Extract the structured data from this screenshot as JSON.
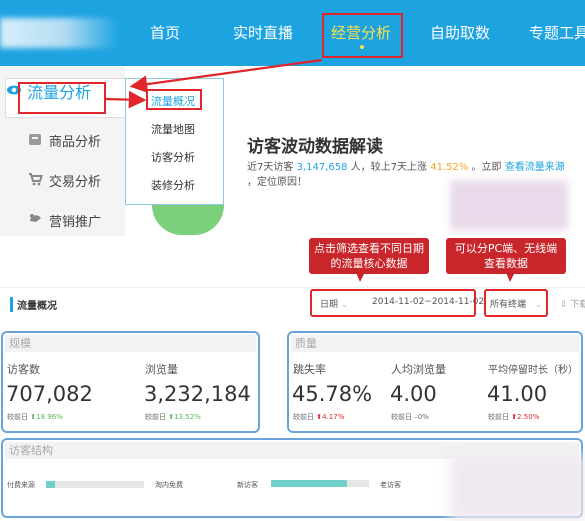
{
  "nav": {
    "items": [
      "首页",
      "实时直播",
      "经营分析",
      "自助取数",
      "专题工具"
    ],
    "active_index": 2
  },
  "sidebar": {
    "items": [
      {
        "label": "流量分析",
        "icon": "eye-icon"
      },
      {
        "label": "商品分析",
        "icon": "product-icon"
      },
      {
        "label": "交易分析",
        "icon": "cart-icon"
      },
      {
        "label": "营销推广",
        "icon": "marketing-icon"
      }
    ],
    "active_index": 0
  },
  "submenu": {
    "items": [
      "流量概况",
      "流量地图",
      "访客分析",
      "装修分析"
    ],
    "active_index": 0
  },
  "headline": {
    "title": "访客波动数据解读",
    "desc_1": "近7天访客",
    "visitors": "3,147,658",
    "desc_2": "人，较上7天上涨",
    "rise": "41.52%",
    "desc_3": "。立即",
    "link": "查看流量来源",
    "desc_4": "，定位原因！"
  },
  "callouts": {
    "date_tip": "点击筛选查看不同日期的流量核心数据",
    "terminal_tip": "可以分PC端、无线端查看数据"
  },
  "toolbar": {
    "section_title": "流量概况",
    "date_label": "日期",
    "date_range": "2014-11-02~2014-11-02",
    "terminal": "所有终端",
    "download": "下载"
  },
  "scale_panel": {
    "title": "规模",
    "metrics": [
      {
        "label": "访客数",
        "value": "707,082",
        "cmp_label": "较前日",
        "cmp": "18.96%"
      },
      {
        "label": "浏览量",
        "value": "3,232,184",
        "cmp_label": "较前日",
        "cmp": "13.52%"
      }
    ]
  },
  "quality_panel": {
    "title": "质量",
    "metrics": [
      {
        "label": "跳失率",
        "value": "45.78%",
        "cmp_label": "较前日",
        "cmp": "4.17%"
      },
      {
        "label": "人均浏览量",
        "value": "4.00",
        "cmp_label": "较前日",
        "cmp": "0%"
      },
      {
        "label": "平均停留时长（秒）",
        "value": "41.00",
        "cmp_label": "较前日",
        "cmp": "2.50%"
      }
    ]
  },
  "structure_panel": {
    "title": "访客结构",
    "items": [
      "付费来源",
      "淘内免费",
      "新访客",
      "老访客"
    ]
  },
  "colors": {
    "brand_blue": "#1ea3e1",
    "highlight_red": "#e0262a",
    "rise_green": "#5cb85c",
    "bar_teal": "#6fd1c9"
  }
}
